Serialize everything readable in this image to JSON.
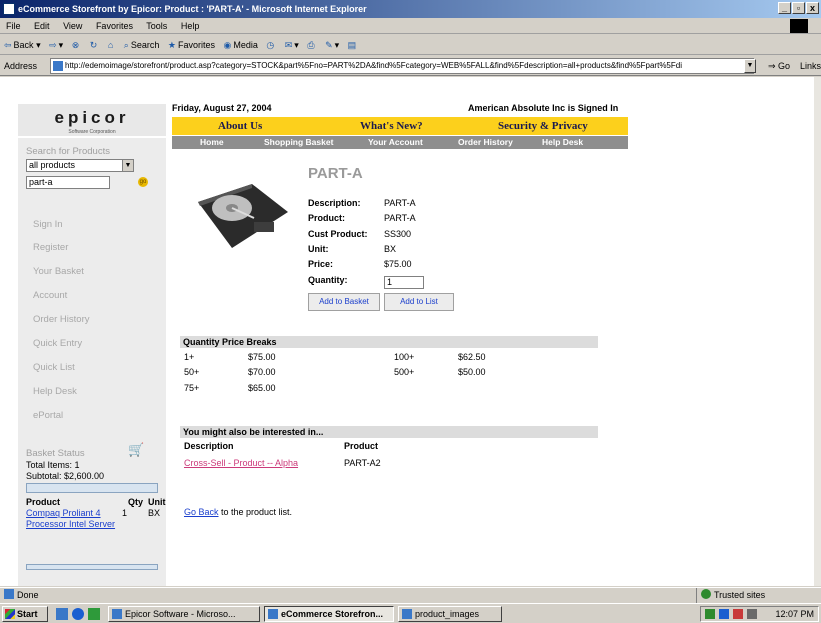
{
  "window": {
    "title": "eCommerce Storefront by Epicor: Product : 'PART-A' - Microsoft Internet Explorer",
    "controls": [
      "_",
      "▫",
      "x"
    ]
  },
  "menubar": [
    "File",
    "Edit",
    "View",
    "Favorites",
    "Tools",
    "Help"
  ],
  "toolbar": {
    "back": "Back",
    "search": "Search",
    "favorites": "Favorites",
    "media": "Media"
  },
  "address": {
    "label": "Address",
    "url": "http://edemoimage/storefront/product.asp?category=STOCK&part%5Fno=PART%2DA&find%5Fcategory=WEB%5FALL&find%5Fdescription=all+products&find%5Fpart%5Fdi",
    "go": "Go",
    "links": "Links"
  },
  "header": {
    "date": "Friday, August 27, 2004",
    "signed_in": "American Absolute Inc is Signed In",
    "logo": "epicor",
    "logo_sub": "Software Corporation"
  },
  "nav_primary": [
    "About Us",
    "What's New?",
    "Security & Privacy"
  ],
  "nav_secondary": [
    "Home",
    "Shopping Basket",
    "Your Account",
    "Order History",
    "Help Desk"
  ],
  "sidebar": {
    "search_title": "Search for Products",
    "category_selected": "all products",
    "search_value": "part-a",
    "go_label": "go",
    "links": [
      "Sign In",
      "Register",
      "Your Basket",
      "Account",
      "Order History",
      "Quick Entry",
      "Quick List",
      "Help Desk",
      "ePortal"
    ]
  },
  "basket": {
    "title": "Basket Status",
    "total_items": "Total Items: 1",
    "subtotal": "Subtotal: $2,600.00",
    "head_product": "Product",
    "head_qty": "Qty",
    "head_unit": "Unit",
    "item_name": "Compaq Proliant 4 Processor Intel Server",
    "item_qty": "1",
    "item_unit": "BX"
  },
  "product": {
    "title": "PART-A",
    "specs": [
      {
        "label": "Description:",
        "value": "PART-A"
      },
      {
        "label": "Product:",
        "value": "PART-A"
      },
      {
        "label": "Cust Product:",
        "value": "SS300"
      },
      {
        "label": "Unit:",
        "value": "BX"
      },
      {
        "label": "Price:",
        "value": "$75.00"
      },
      {
        "label": "Quantity:",
        "value": ""
      }
    ],
    "quantity": "1",
    "add_basket": "Add to Basket",
    "add_list": "Add to List"
  },
  "price_breaks": {
    "title": "Quantity Price Breaks",
    "rows": [
      {
        "qty": "1+",
        "price": "$75.00"
      },
      {
        "qty": "50+",
        "price": "$70.00"
      },
      {
        "qty": "75+",
        "price": "$65.00"
      },
      {
        "qty": "100+",
        "price": "$62.50"
      },
      {
        "qty": "500+",
        "price": "$50.00"
      }
    ]
  },
  "cross_sell": {
    "title": "You might also be interested in...",
    "col_description": "Description",
    "col_product": "Product",
    "link": "Cross-Sell - Product -- Alpha",
    "product": "PART-A2"
  },
  "go_back": {
    "link": "Go Back",
    "text": " to the product list."
  },
  "status": {
    "text": "Done",
    "zone": "Trusted sites"
  },
  "taskbar": {
    "start": "Start",
    "tasks": [
      "Epicor Software - Microso...",
      "eCommerce Storefron...",
      "product_images"
    ],
    "clock": "12:07 PM"
  }
}
